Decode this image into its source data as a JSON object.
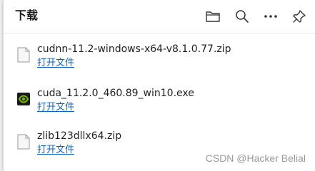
{
  "header": {
    "title": "下载"
  },
  "toolbar": {
    "icons": [
      "folder-icon",
      "search-icon",
      "more-icon",
      "pin-icon"
    ]
  },
  "downloads": [
    {
      "filename": "cudnn-11.2-windows-x64-v8.1.0.77.zip",
      "action": "打开文件",
      "icon": "zip-file-icon"
    },
    {
      "filename": "cuda_11.2.0_460.89_win10.exe",
      "action": "打开文件",
      "icon": "nvidia-installer-icon"
    },
    {
      "filename": "zlib123dllx64.zip",
      "action": "打开文件",
      "icon": "zip-file-icon"
    }
  ],
  "watermark": "CSDN @Hacker Belial",
  "colors": {
    "link": "#0b62c4",
    "nvidia_green": "#76b900"
  }
}
